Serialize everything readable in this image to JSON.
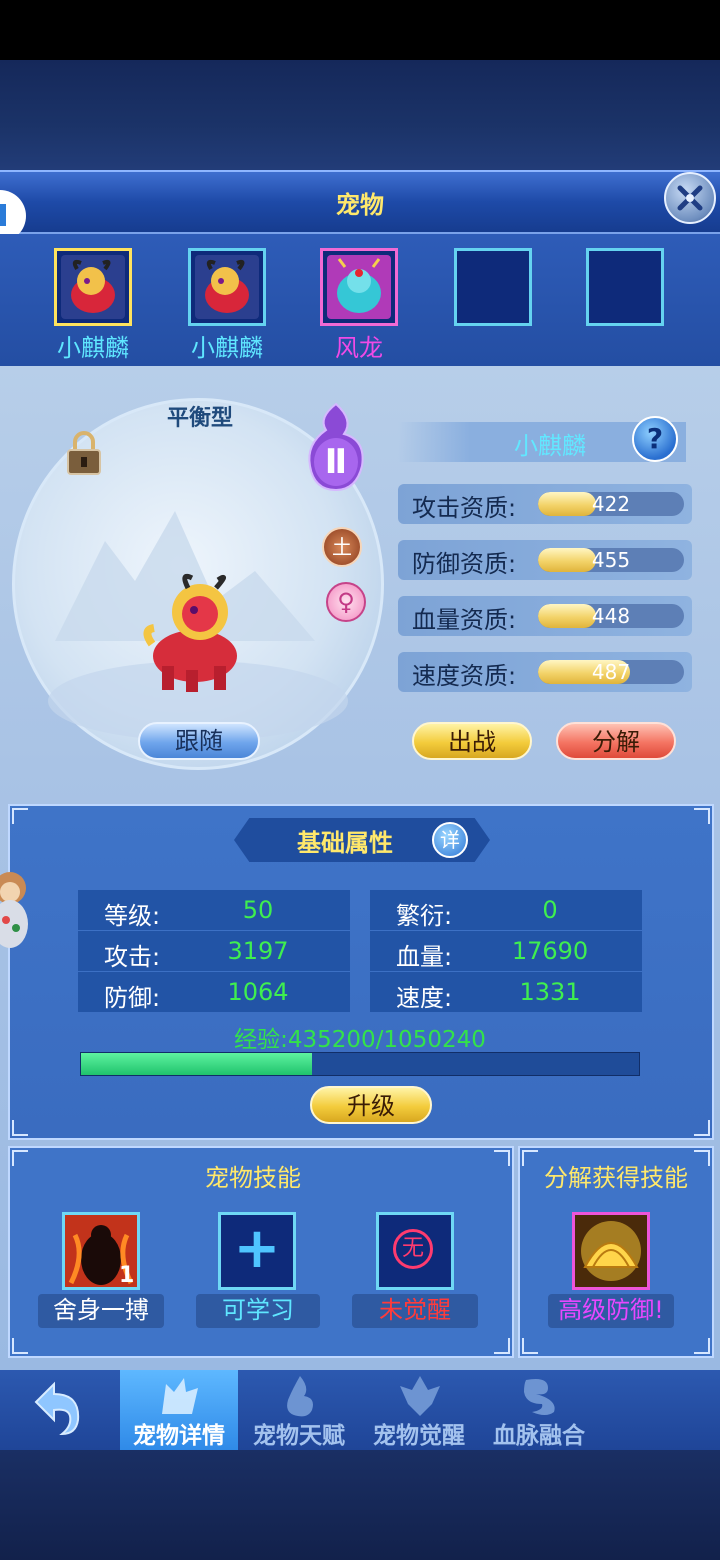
{
  "title": "宠物",
  "pets": [
    {
      "name": "小麒麟",
      "frame": "gold",
      "name_color": "#5fe6ff"
    },
    {
      "name": "小麒麟",
      "frame": "cyan",
      "name_color": "#5fe6ff"
    },
    {
      "name": "风龙",
      "frame": "pink",
      "name_color": "#f04ae6"
    },
    {
      "name": "",
      "frame": "cyan"
    },
    {
      "name": "",
      "frame": "cyan"
    }
  ],
  "pet_detail": {
    "type": "平衡型",
    "grade": "Ⅱ",
    "element": "土",
    "gender": "♀",
    "name": "小麒麟",
    "help": "?",
    "follow_label": "跟随",
    "battle_label": "出战",
    "decompose_label": "分解"
  },
  "aptitudes": [
    {
      "label": "攻击资质:",
      "value": "422",
      "fill": 0.4
    },
    {
      "label": "防御资质:",
      "value": "455",
      "fill": 0.4
    },
    {
      "label": "血量资质:",
      "value": "448",
      "fill": 0.4
    },
    {
      "label": "速度资质:",
      "value": "487",
      "fill": 0.63
    }
  ],
  "base_attributes": {
    "title": "基础属性",
    "detail_label": "详",
    "stats": [
      {
        "label": "等级:",
        "value": "50"
      },
      {
        "label": "繁衍:",
        "value": "0"
      },
      {
        "label": "攻击:",
        "value": "3197"
      },
      {
        "label": "血量:",
        "value": "17690"
      },
      {
        "label": "防御:",
        "value": "1064"
      },
      {
        "label": "速度:",
        "value": "1331"
      }
    ],
    "exp_text": "经验:435200/1050240",
    "exp_fraction": 0.4144,
    "upgrade_label": "升级"
  },
  "skills": {
    "title": "宠物技能",
    "items": [
      {
        "label": "舍身一搏",
        "level": "1",
        "label_color": "#ffffff"
      },
      {
        "label": "可学习",
        "icon_text": "+",
        "label_color": "#5fe6ff"
      },
      {
        "label": "未觉醒",
        "icon_text": "无",
        "label_color": "#ff3b3b"
      }
    ]
  },
  "decompose_skills": {
    "title": "分解获得技能",
    "items": [
      {
        "label": "高级防御!",
        "label_color": "#e847ff"
      }
    ]
  },
  "nav": {
    "back": "back",
    "tabs": [
      {
        "label": "宠物详情",
        "active": true
      },
      {
        "label": "宠物天赋",
        "active": false
      },
      {
        "label": "宠物觉醒",
        "active": false
      },
      {
        "label": "血脉融合",
        "active": false
      }
    ]
  },
  "colors": {
    "title": "#ffe86b",
    "stat_value": "#3fef4f",
    "exp_text": "#33e24a"
  }
}
